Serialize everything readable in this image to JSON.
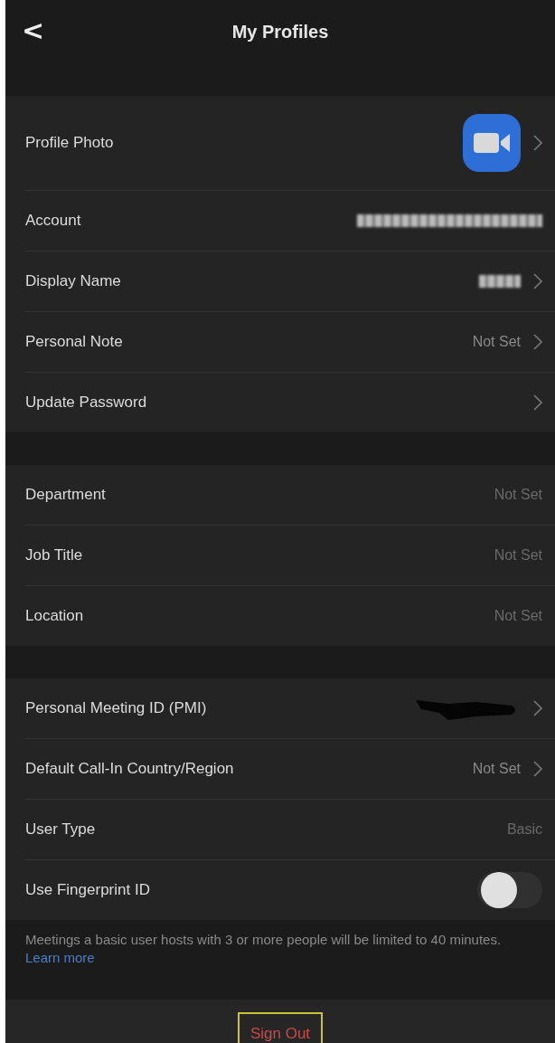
{
  "header": {
    "back": "<",
    "title": "My Profiles"
  },
  "sections": [
    {
      "rows": [
        {
          "label": "Profile Photo",
          "kind": "photo",
          "chevron": true
        },
        {
          "label": "Account",
          "kind": "redacted",
          "chevron": false
        },
        {
          "label": "Display Name",
          "kind": "redacted",
          "chevron": true
        },
        {
          "label": "Personal Note",
          "kind": "text",
          "value": "Not Set",
          "chevron": true
        },
        {
          "label": "Update Password",
          "kind": "none",
          "chevron": true
        }
      ]
    },
    {
      "rows": [
        {
          "label": "Department",
          "kind": "text",
          "value": "Not Set",
          "chevron": false
        },
        {
          "label": "Job Title",
          "kind": "text",
          "value": "Not Set",
          "chevron": false
        },
        {
          "label": "Location",
          "kind": "text",
          "value": "Not Set",
          "chevron": false
        }
      ]
    },
    {
      "rows": [
        {
          "label": "Personal Meeting ID (PMI)",
          "kind": "scribbled",
          "chevron": true
        },
        {
          "label": "Default Call-In Country/Region",
          "kind": "text",
          "value": "Not Set",
          "chevron": true
        },
        {
          "label": "User Type",
          "kind": "text",
          "value": "Basic",
          "chevron": false
        },
        {
          "label": "Use Fingerprint ID",
          "kind": "toggle",
          "on": false
        }
      ]
    }
  ],
  "note": {
    "text": "Meetings a basic user hosts with 3 or more people will be limited to 40 minutes.",
    "link": "Learn more"
  },
  "sign_out": {
    "label": "Sign Out",
    "highlighted": true
  }
}
